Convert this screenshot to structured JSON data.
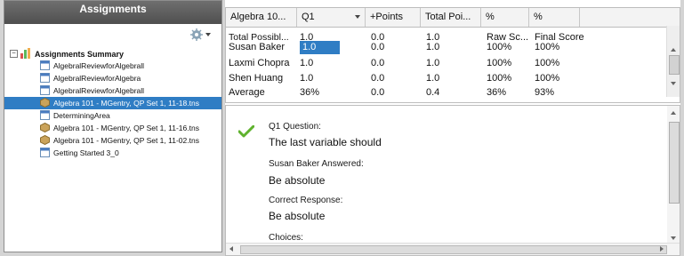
{
  "left_panel": {
    "title": "Assignments",
    "tree": {
      "root_label": "Assignments Summary",
      "items": [
        {
          "label": "AlgebralReviewforAlgebrall",
          "icon": "doc-icon"
        },
        {
          "label": "AlgebralReviewforAlgebra",
          "icon": "doc-icon"
        },
        {
          "label": "AlgebralReviewforAlgebrall",
          "icon": "doc-icon"
        },
        {
          "label": "Algebra 101 - MGentry, QP Set 1, 11-18.tns",
          "icon": "tns-icon",
          "selected": true
        },
        {
          "label": "DeterminingArea",
          "icon": "doc-icon"
        },
        {
          "label": "Algebra 101 - MGentry, QP Set 1, 11-16.tns",
          "icon": "tns-icon"
        },
        {
          "label": "Algebra 101 - MGentry, QP Set 1, 11-02.tns",
          "icon": "tns-icon"
        },
        {
          "label": "Getting Started 3_0",
          "icon": "doc-icon"
        }
      ]
    }
  },
  "grid": {
    "headers": [
      "Algebra 10...",
      "Q1",
      "+Points",
      "Total Poi...",
      "%",
      "%"
    ],
    "rows": [
      [
        "Total Possibl...",
        "1.0",
        "0.0",
        "1.0",
        "Raw Sc...",
        "Final Score"
      ],
      [
        "Susan Baker",
        "1.0",
        "0.0",
        "1.0",
        "100%",
        "100%"
      ],
      [
        "Laxmi Chopra",
        "1.0",
        "0.0",
        "1.0",
        "100%",
        "100%"
      ],
      [
        "Shen Huang",
        "1.0",
        "0.0",
        "1.0",
        "100%",
        "100%"
      ],
      [
        "Average",
        "36%",
        "0.0",
        "0.4",
        "36%",
        "93%"
      ]
    ]
  },
  "detail": {
    "question_label": "Q1 Question:",
    "question_text": "The last variable should",
    "answer_label": "Susan Baker Answered:",
    "answer_text": "Be absolute",
    "correct_label": "Correct Response:",
    "correct_text": "Be absolute",
    "choices_label": "Choices:"
  },
  "colors": {
    "selection": "#2f7dc4",
    "header_dark": "#5c5c5c",
    "check_green": "#5fb22e"
  }
}
